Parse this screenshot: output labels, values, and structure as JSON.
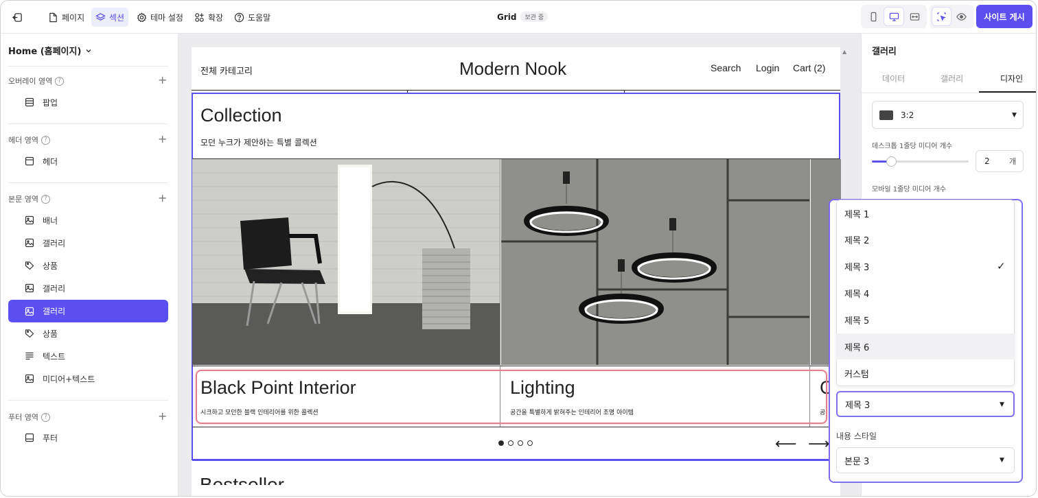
{
  "topbar": {
    "back_icon": "exit-icon",
    "nav": [
      {
        "label": "페이지",
        "icon": "page-icon"
      },
      {
        "label": "섹션",
        "icon": "layers-icon"
      },
      {
        "label": "테마 설정",
        "icon": "gear-icon"
      },
      {
        "label": "확장",
        "icon": "apps-icon"
      },
      {
        "label": "도움말",
        "icon": "help-icon"
      }
    ],
    "title": "Grid",
    "badge": "보관 중",
    "publish": "사이트 게시",
    "accent": "#5b4ff0"
  },
  "sidebar": {
    "page_selector": "Home (홈페이지)",
    "sections": [
      {
        "label": "오버레이 영역",
        "items": [
          {
            "label": "팝업",
            "icon": "popup-icon"
          }
        ]
      },
      {
        "label": "헤더 영역",
        "items": [
          {
            "label": "헤더",
            "icon": "header-icon"
          }
        ]
      },
      {
        "label": "본문 영역",
        "items": [
          {
            "label": "배너",
            "icon": "image-icon"
          },
          {
            "label": "갤러리",
            "icon": "image-icon"
          },
          {
            "label": "상품",
            "icon": "tag-icon"
          },
          {
            "label": "갤러리",
            "icon": "image-icon"
          },
          {
            "label": "갤러리",
            "icon": "image-icon",
            "selected": true
          },
          {
            "label": "상품",
            "icon": "tag-icon"
          },
          {
            "label": "텍스트",
            "icon": "text-icon"
          },
          {
            "label": "미디어+텍스트",
            "icon": "image-icon"
          }
        ]
      },
      {
        "label": "푸터 영역",
        "items": [
          {
            "label": "푸터",
            "icon": "footer-icon"
          }
        ]
      }
    ]
  },
  "preview": {
    "nav_left": "전체 카테고리",
    "brand": "Modern Nook",
    "nav_right": [
      "Search",
      "Login",
      "Cart (2)"
    ],
    "collection_title": "Collection",
    "collection_subtitle": "모던 누크가 제안하는 특별 콜렉션",
    "cards": [
      {
        "title": "Black Point Interior",
        "desc": "시크하고 모던한 블랙 인테리어를 위한 콜렉션"
      },
      {
        "title": "Lighting",
        "desc": "공간을 특별하게 밝혀주는 인테리어 조명 아이템"
      },
      {
        "title": "C",
        "desc": "공"
      }
    ],
    "dots": 4,
    "active_dot": 1,
    "next_section": "Bestseller"
  },
  "panel": {
    "title": "갤러리",
    "tabs": [
      "데이터",
      "갤러리",
      "디자인"
    ],
    "selected_tab": "디자인",
    "ratio": "3:2",
    "desktop_label": "데스크톱 1줄당 미디어 개수",
    "desktop_value": "2",
    "unit": "개",
    "desktop_slider": 0.2,
    "mobile_label": "모바일 1줄당 미디어 개수"
  },
  "dropdown": {
    "options": [
      "제목 1",
      "제목 2",
      "제목 3",
      "제목 4",
      "제목 5",
      "제목 6",
      "커스텀"
    ],
    "checked": "제목 3",
    "hovered": "제목 6",
    "selected_value": "제목 3",
    "content_style_label": "내용 스타일",
    "content_style_value": "본문 3"
  }
}
